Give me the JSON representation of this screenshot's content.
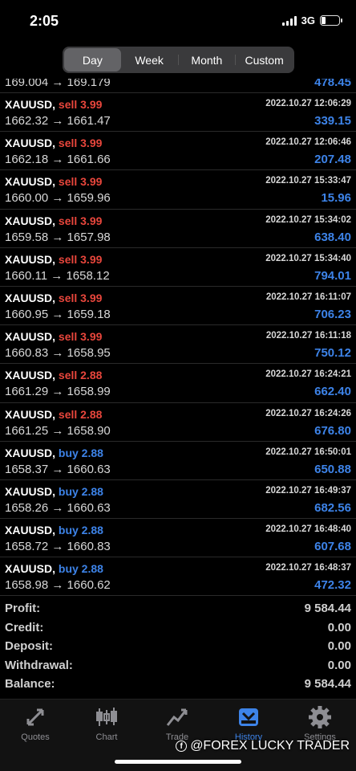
{
  "status": {
    "time": "2:05",
    "network": "3G"
  },
  "periods": [
    "Day",
    "Week",
    "Month",
    "Custom"
  ],
  "partial_row": {
    "prices": "169.004 → 169.179",
    "profit": "478.45"
  },
  "trades": [
    {
      "symbol": "XAUUSD,",
      "side": "sell",
      "volume": "sell 3.99",
      "date": "2022.10.27 12:06:29",
      "prices": "1662.32 → 1661.47",
      "profit": "339.15"
    },
    {
      "symbol": "XAUUSD,",
      "side": "sell",
      "volume": "sell 3.99",
      "date": "2022.10.27 12:06:46",
      "prices": "1662.18 → 1661.66",
      "profit": "207.48"
    },
    {
      "symbol": "XAUUSD,",
      "side": "sell",
      "volume": "sell 3.99",
      "date": "2022.10.27 15:33:47",
      "prices": "1660.00 → 1659.96",
      "profit": "15.96"
    },
    {
      "symbol": "XAUUSD,",
      "side": "sell",
      "volume": "sell 3.99",
      "date": "2022.10.27 15:34:02",
      "prices": "1659.58 → 1657.98",
      "profit": "638.40"
    },
    {
      "symbol": "XAUUSD,",
      "side": "sell",
      "volume": "sell 3.99",
      "date": "2022.10.27 15:34:40",
      "prices": "1660.11 → 1658.12",
      "profit": "794.01"
    },
    {
      "symbol": "XAUUSD,",
      "side": "sell",
      "volume": "sell 3.99",
      "date": "2022.10.27 16:11:07",
      "prices": "1660.95 → 1659.18",
      "profit": "706.23"
    },
    {
      "symbol": "XAUUSD,",
      "side": "sell",
      "volume": "sell 3.99",
      "date": "2022.10.27 16:11:18",
      "prices": "1660.83 → 1658.95",
      "profit": "750.12"
    },
    {
      "symbol": "XAUUSD,",
      "side": "sell",
      "volume": "sell 2.88",
      "date": "2022.10.27 16:24:21",
      "prices": "1661.29 → 1658.99",
      "profit": "662.40"
    },
    {
      "symbol": "XAUUSD,",
      "side": "sell",
      "volume": "sell 2.88",
      "date": "2022.10.27 16:24:26",
      "prices": "1661.25 → 1658.90",
      "profit": "676.80"
    },
    {
      "symbol": "XAUUSD,",
      "side": "buy",
      "volume": "buy 2.88",
      "date": "2022.10.27 16:50:01",
      "prices": "1658.37 → 1660.63",
      "profit": "650.88"
    },
    {
      "symbol": "XAUUSD,",
      "side": "buy",
      "volume": "buy 2.88",
      "date": "2022.10.27 16:49:37",
      "prices": "1658.26 → 1660.63",
      "profit": "682.56"
    },
    {
      "symbol": "XAUUSD,",
      "side": "buy",
      "volume": "buy 2.88",
      "date": "2022.10.27 16:48:40",
      "prices": "1658.72 → 1660.83",
      "profit": "607.68"
    },
    {
      "symbol": "XAUUSD,",
      "side": "buy",
      "volume": "buy 2.88",
      "date": "2022.10.27 16:48:37",
      "prices": "1658.98 → 1660.62",
      "profit": "472.32"
    }
  ],
  "summary": [
    {
      "label": "Profit:",
      "value": "9 584.44"
    },
    {
      "label": "Credit:",
      "value": "0.00"
    },
    {
      "label": "Deposit:",
      "value": "0.00"
    },
    {
      "label": "Withdrawal:",
      "value": "0.00"
    },
    {
      "label": "Balance:",
      "value": "9 584.44"
    }
  ],
  "tabs": [
    {
      "label": "Quotes",
      "icon": "quotes-icon"
    },
    {
      "label": "Chart",
      "icon": "chart-icon"
    },
    {
      "label": "Trade",
      "icon": "trade-icon"
    },
    {
      "label": "History",
      "icon": "history-icon"
    },
    {
      "label": "Settings",
      "icon": "settings-icon"
    }
  ],
  "watermark": "@FOREX LUCKY TRADER",
  "colors": {
    "sell": "#e8463c",
    "buy": "#3d83e8",
    "profit": "#3d83e8",
    "active_tab": "#3d83e8"
  }
}
